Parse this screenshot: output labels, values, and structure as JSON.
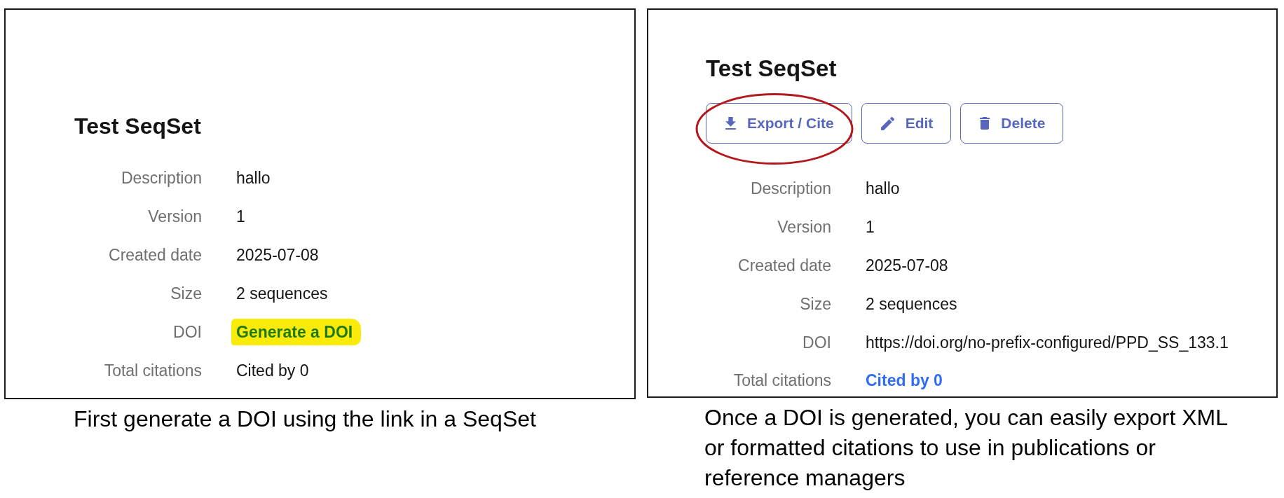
{
  "panels": [
    {
      "title": "Test SeqSet",
      "fields": [
        {
          "label": "Description",
          "value": "hallo",
          "kind": "text",
          "highlighted": false
        },
        {
          "label": "Version",
          "value": "1",
          "kind": "text",
          "highlighted": false
        },
        {
          "label": "Created date",
          "value": "2025-07-08",
          "kind": "text",
          "highlighted": false
        },
        {
          "label": "Size",
          "value": "2 sequences",
          "kind": "text",
          "highlighted": false
        },
        {
          "label": "DOI",
          "value": "Generate a DOI",
          "kind": "link",
          "highlighted": true
        },
        {
          "label": "Total citations",
          "value": "Cited by 0",
          "kind": "text",
          "highlighted": false
        }
      ],
      "caption": "First generate a DOI using the link in a SeqSet"
    },
    {
      "title": "Test SeqSet",
      "actions": [
        {
          "label": "Export / Cite",
          "kind": "export",
          "circled": true
        },
        {
          "label": "Edit",
          "kind": "edit",
          "circled": false
        },
        {
          "label": "Delete",
          "kind": "delete",
          "circled": false
        }
      ],
      "fields": [
        {
          "label": "Description",
          "value": "hallo",
          "kind": "text",
          "highlighted": false
        },
        {
          "label": "Version",
          "value": "1",
          "kind": "text",
          "highlighted": false
        },
        {
          "label": "Created date",
          "value": "2025-07-08",
          "kind": "text",
          "highlighted": false
        },
        {
          "label": "Size",
          "value": "2 sequences",
          "kind": "text",
          "highlighted": false
        },
        {
          "label": "DOI",
          "value": "https://doi.org/no-prefix-configured/PPD_SS_133.1",
          "kind": "text",
          "highlighted": false
        },
        {
          "label": "Total citations",
          "value": "Cited by 0",
          "kind": "link",
          "highlighted": false
        }
      ],
      "caption": "Once a DOI is generated, you can easily export XML or formatted citations to use in publications or reference managers"
    }
  ]
}
